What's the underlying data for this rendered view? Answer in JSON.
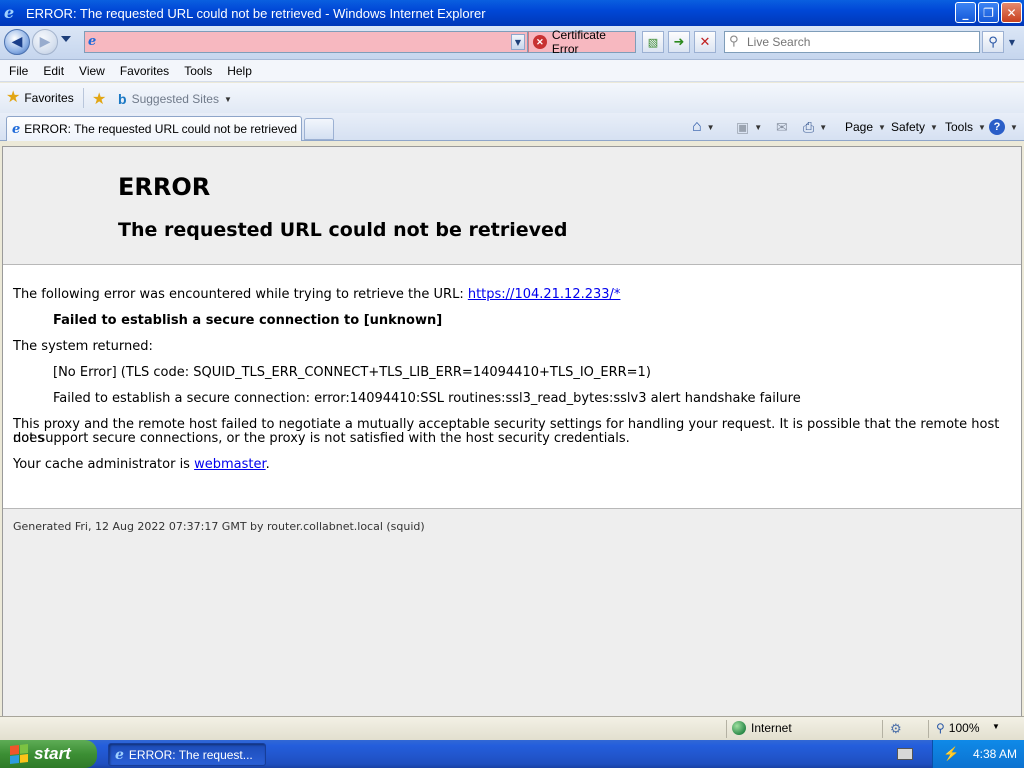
{
  "window": {
    "title": "ERROR: The requested URL could not be retrieved - Windows Internet Explorer",
    "buttons": {
      "minimize": "_",
      "maximize": "❐",
      "close": "✕"
    }
  },
  "addressbar": {
    "url_value": "",
    "cert_error_label": "Certificate Error",
    "search_placeholder": "Live Search"
  },
  "menu": [
    "File",
    "Edit",
    "View",
    "Favorites",
    "Tools",
    "Help"
  ],
  "favorites_bar": {
    "favorites_label": "Favorites",
    "suggested_sites_label": "Suggested Sites"
  },
  "tabs": [
    {
      "label": "ERROR: The requested URL could not be retrieved"
    }
  ],
  "command_bar": {
    "page_label": "Page",
    "safety_label": "Safety",
    "tools_label": "Tools",
    "help_label": "?"
  },
  "page": {
    "heading": "ERROR",
    "subheading": "The requested URL could not be retrieved",
    "intro_text": "The following error was encountered while trying to retrieve the URL: ",
    "intro_link": "https://104.21.12.233/*",
    "error_summary": "Failed to establish a secure connection to [unknown]",
    "system_returned": "The system returned:",
    "tls_code": "[No Error] (TLS code: SQUID_TLS_ERR_CONNECT+TLS_LIB_ERR=14094410+TLS_IO_ERR=1)",
    "ssl_error": "Failed to establish a secure connection: error:14094410:SSL routines:ssl3_read_bytes:sslv3 alert handshake failure",
    "explanation_line1": "This proxy and the remote host failed to negotiate a mutually acceptable security settings for handling your request. It is possible that the remote host does",
    "explanation_line2": "not support secure connections, or the proxy is not satisfied with the host security credentials.",
    "admin_text": "Your cache administrator is ",
    "admin_link": "webmaster",
    "admin_suffix": ".",
    "footer": "Generated Fri, 12 Aug 2022 07:37:17 GMT by router.collabnet.local (squid)"
  },
  "statusbar": {
    "zone": "Internet",
    "zoom": "100%"
  },
  "taskbar": {
    "start_label": "start",
    "task_item": "ERROR: The request...",
    "clock": "4:38 AM"
  }
}
